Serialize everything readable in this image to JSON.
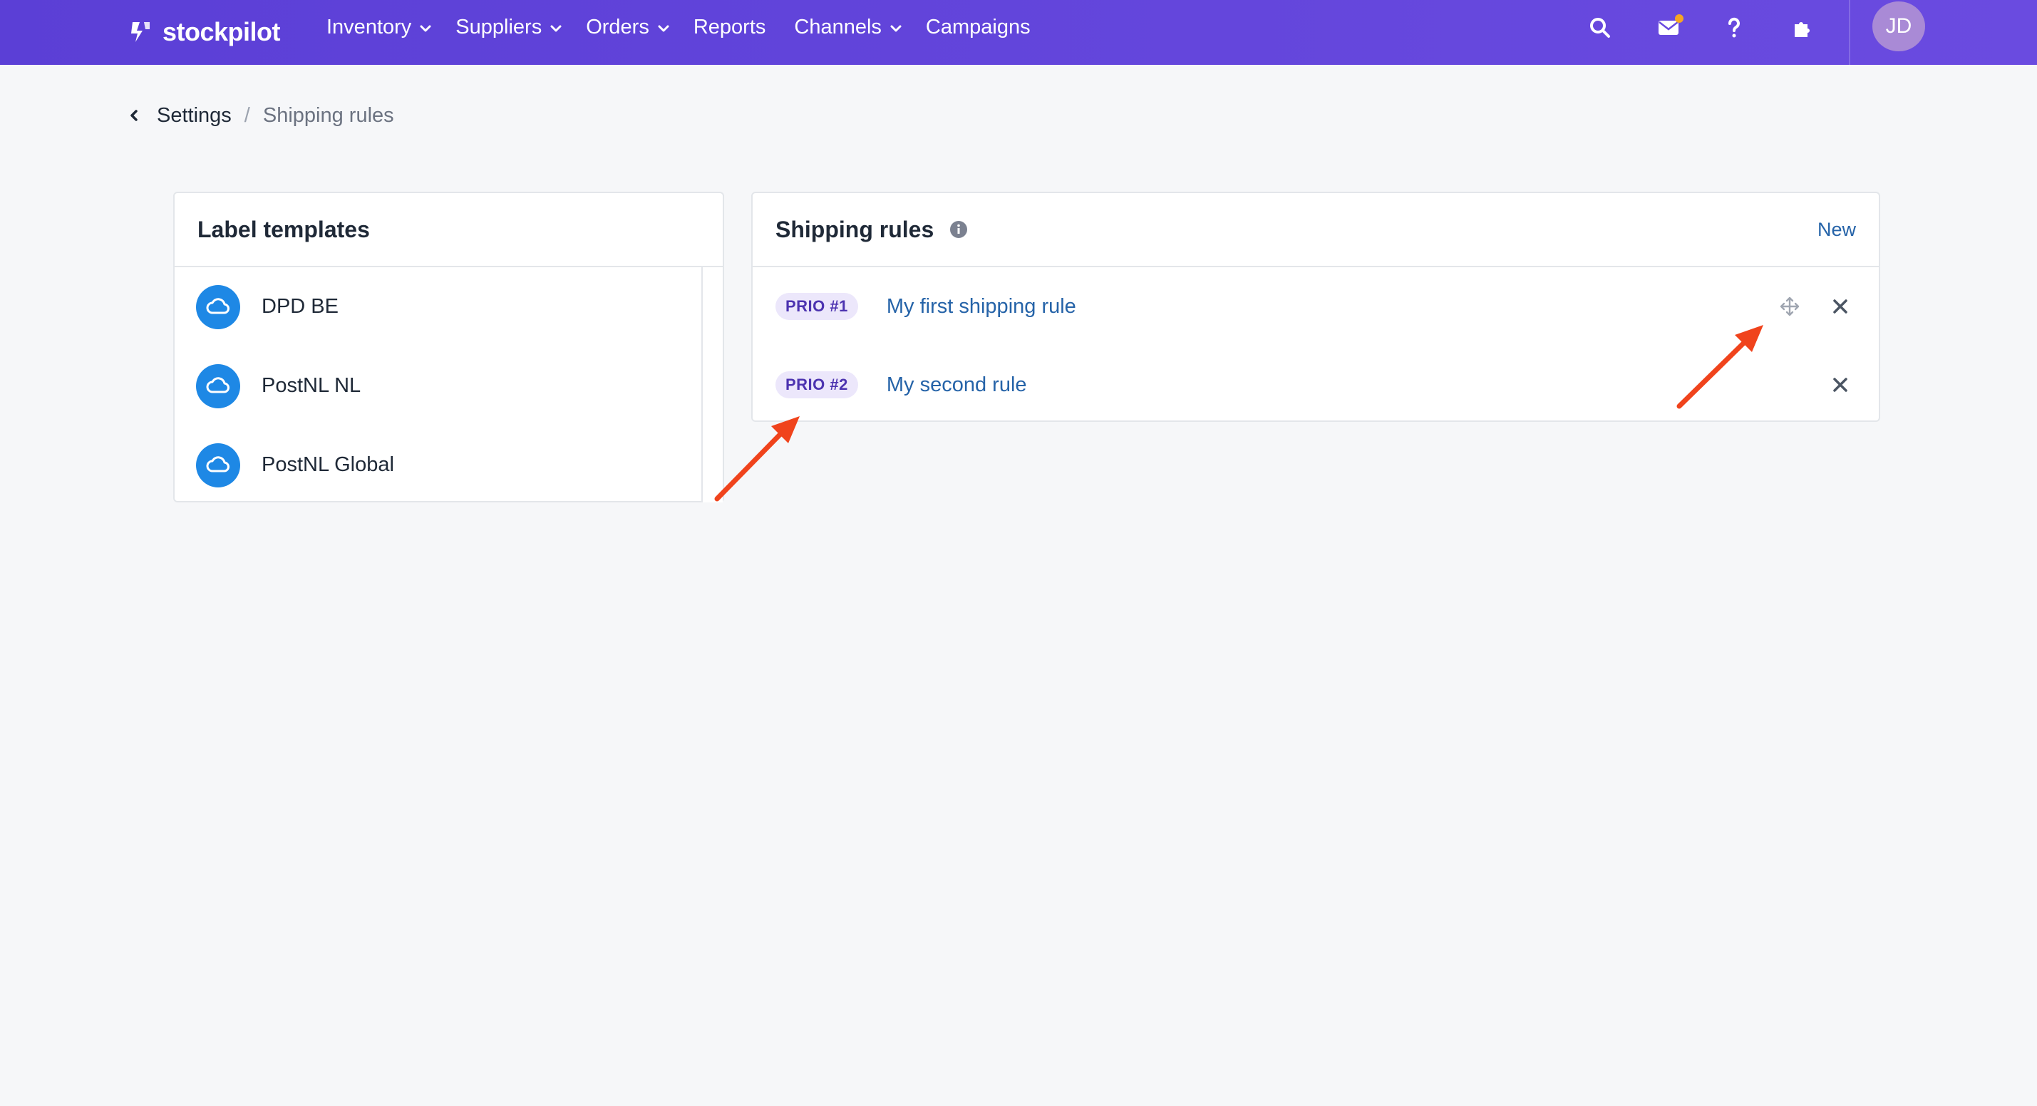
{
  "app": {
    "name": "stockpilot"
  },
  "nav": {
    "items": [
      {
        "label": "Inventory",
        "has_dropdown": true
      },
      {
        "label": "Suppliers",
        "has_dropdown": true
      },
      {
        "label": "Orders",
        "has_dropdown": true
      },
      {
        "label": "Reports",
        "has_dropdown": false
      },
      {
        "label": "Channels",
        "has_dropdown": true
      },
      {
        "label": "Campaigns",
        "has_dropdown": false
      }
    ],
    "icons": [
      "search-icon",
      "mail-icon",
      "help-icon",
      "puzzle-icon"
    ],
    "avatar_initials": "JD"
  },
  "breadcrumb": {
    "parent": "Settings",
    "separator": "/",
    "current": "Shipping rules"
  },
  "label_templates": {
    "title": "Label templates",
    "items": [
      {
        "label": "DPD BE",
        "icon": "cloud-icon"
      },
      {
        "label": "PostNL NL",
        "icon": "cloud-icon"
      },
      {
        "label": "PostNL Global",
        "icon": "cloud-icon"
      }
    ]
  },
  "shipping_rules": {
    "title": "Shipping rules",
    "new_label": "New",
    "rules": [
      {
        "prio": "PRIO #1",
        "name": "My first shipping rule",
        "show_move": true
      },
      {
        "prio": "PRIO #2",
        "name": "My second rule",
        "show_move": false
      }
    ]
  },
  "colors": {
    "nav_bg": "#5b3fd6",
    "accent_blue": "#1e88e5",
    "link": "#2563a8",
    "annotation_arrow": "#f0431c",
    "mail_dot": "#f5a524"
  }
}
